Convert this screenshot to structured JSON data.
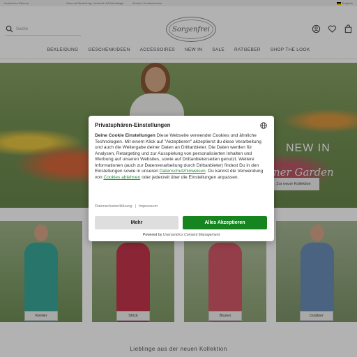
{
  "topbar": {
    "items": [
      "Kostenlose Retoure",
      "Ganz auf Bestellung: Lieferzeit 4-8 Arbeitstage",
      "Service: Kundenservice"
    ],
    "language": "Englisch"
  },
  "header": {
    "search_placeholder": "Suche",
    "logo_text": "Sorgenfrei",
    "nav": [
      "BEKLEIDUNG",
      "GESCHENKIDEEN",
      "ACCESSOIRES",
      "NEW IN",
      "SALE",
      "RATGEBER",
      "SHOP THE LOOK"
    ]
  },
  "hero": {
    "title": "NEW IN",
    "subtitle": "ner Garden",
    "button": "Zur neuer Kollektion"
  },
  "categories": [
    {
      "label": "Kleider",
      "color": "#3aa89a"
    },
    {
      "label": "Strick",
      "color": "#c4364b"
    },
    {
      "label": "Blusen",
      "color": "#d45a6a"
    },
    {
      "label": "Outdoor",
      "color": "#6a8fb8"
    }
  ],
  "favorites_title": "Lieblinge aus der neuen Kollektion",
  "consent": {
    "title": "Privatsphären-Einstellungen",
    "heading": "Deine Cookie Einstellungen",
    "text_part1": " Diese Webseite verwendet Cookies und ähnliche Technologien. Mit einem Klick auf \"Akzeptieren\" akzeptierst du diese Verarbeitung und auch die Weitergabe deiner Daten an Drittanbieter. Die Daten werden für Analysen, Retargeting und zur Ausspielung von personalisierten Inhalten und Werbung auf unseren Websites, sowie auf Drittanbieterseiten genutzt. Weitere Informationen (auch zur Datenverarbeitung durch Drittanbieter) findest Du in den Einstellungen sowie in unseren ",
    "privacy_link": "Datenschutzhinweisen",
    "text_part2": ". Du kannst die Verwendung von ",
    "reject_link": "Cookies ablehnen",
    "text_part3": " oder jederzeit über die Einstellungen anpassen.",
    "link_privacy": "Datenschutzerklärung",
    "link_imprint": "Impressum",
    "more_button": "Mehr",
    "accept_button": "Alles Akzeptieren",
    "powered_prefix": "Powered by ",
    "powered_brand": "Usercentrics Consent Management"
  },
  "colors": {
    "accept": "#16851f",
    "link": "#2b8a3e"
  }
}
